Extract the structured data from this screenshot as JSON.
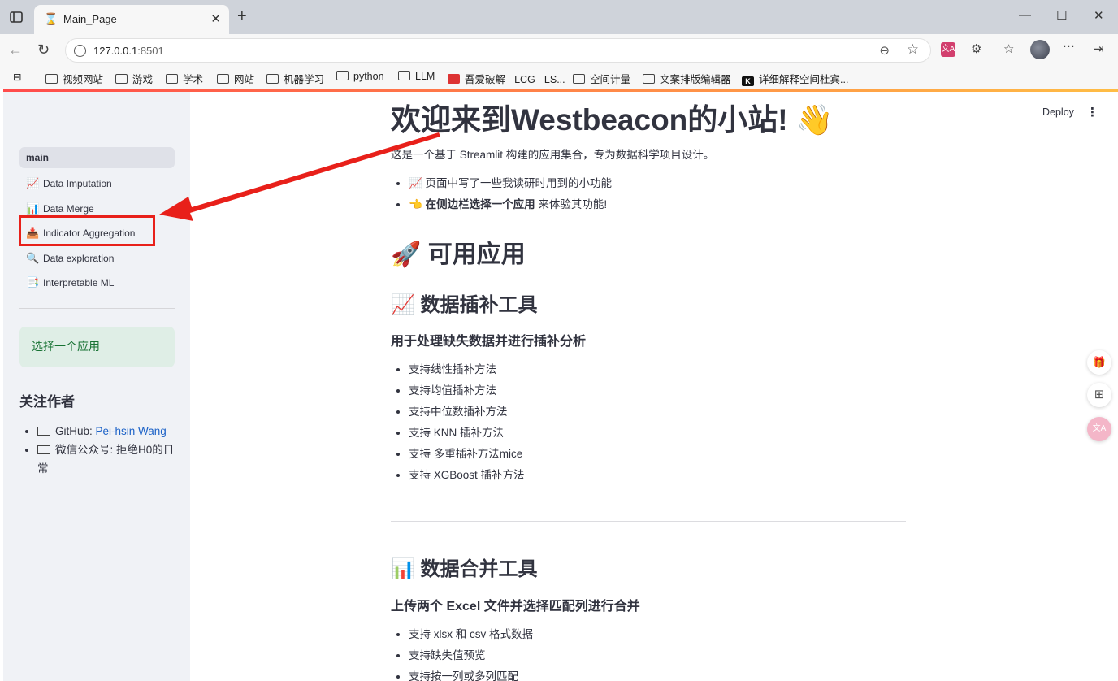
{
  "browser": {
    "tab_title": "Main_Page",
    "tab_favicon": "⌛",
    "url_host": "127.0.0.1",
    "url_port": ":8501",
    "bookmarks": [
      {
        "label": "视频网站",
        "icon": "folder-icon"
      },
      {
        "label": "游戏",
        "icon": "folder-icon"
      },
      {
        "label": "学术",
        "icon": "folder-icon"
      },
      {
        "label": "网站",
        "icon": "folder-icon"
      },
      {
        "label": "机器学习",
        "icon": "folder-icon"
      },
      {
        "label": "python",
        "icon": "folder-icon"
      },
      {
        "label": "LLM",
        "icon": "folder-icon"
      },
      {
        "label": "吾爱破解 - LCG - LS...",
        "icon": "site-icon"
      },
      {
        "label": "空间计量",
        "icon": "folder-icon"
      },
      {
        "label": "文案排版编辑器",
        "icon": "folder-icon"
      },
      {
        "label": "详细解释空间杜宾...",
        "icon": "site-icon"
      }
    ]
  },
  "sidebar": {
    "nav": [
      {
        "label": "main",
        "emoji": "",
        "active": true
      },
      {
        "label": "Data Imputation",
        "emoji": "📈"
      },
      {
        "label": "Data Merge",
        "emoji": "📊"
      },
      {
        "label": "Indicator Aggregation",
        "emoji": "📥"
      },
      {
        "label": "Data exploration",
        "emoji": "🔍"
      },
      {
        "label": "Interpretable ML",
        "emoji": "📑"
      }
    ],
    "info_text": "选择一个应用",
    "follow_title": "关注作者",
    "github_prefix": "GitHub: ",
    "github_link": "Pei-hsin Wang",
    "wechat_text": "微信公众号: 拒绝H0的日常"
  },
  "header": {
    "deploy_label": "Deploy",
    "menu_icon": "⋮"
  },
  "main": {
    "title": "欢迎来到Westbeacon的小站! 👋",
    "intro": "这是一个基于 Streamlit 构建的应用集合，专为数据科学项目设计。",
    "bullet1": "📈 页面中写了一些我读研时用到的小功能",
    "bullet2_icon": "👈",
    "bullet2_bold": "在侧边栏选择一个应用",
    "bullet2_rest": " 来体验其功能!",
    "apps_heading": "🚀 可用应用",
    "imputation": {
      "heading": "📈 数据插补工具",
      "subheading": "用于处理缺失数据并进行插补分析",
      "features": [
        "支持线性插补方法",
        "支持均值插补方法",
        "支持中位数插补方法",
        "支持 KNN 插补方法",
        "支持 多重插补方法mice",
        "支持 XGBoost 插补方法"
      ]
    },
    "merge": {
      "heading": "📊 数据合并工具",
      "subheading": "上传两个 Excel 文件并选择匹配列进行合并",
      "features": [
        "支持 xlsx 和 csv 格式数据",
        "支持缺失值预览",
        "支持按一列或多列匹配"
      ]
    }
  }
}
